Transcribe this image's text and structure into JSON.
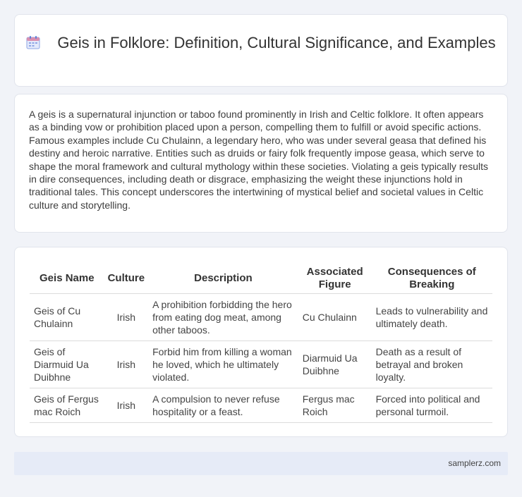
{
  "header": {
    "title": "Geis in Folklore: Definition, Cultural Significance, and Examples",
    "icon": "calendar-icon"
  },
  "intro": {
    "text": "A geis is a supernatural injunction or taboo found prominently in Irish and Celtic folklore. It often appears as a binding vow or prohibition placed upon a person, compelling them to fulfill or avoid specific actions. Famous examples include Cu Chulainn, a legendary hero, who was under several geasa that defined his destiny and heroic narrative. Entities such as druids or fairy folk frequently impose geasa, which serve to shape the moral framework and cultural mythology within these societies. Violating a geis typically results in dire consequences, including death or disgrace, emphasizing the weight these injunctions hold in traditional tales. This concept underscores the intertwining of mystical belief and societal values in Celtic culture and storytelling."
  },
  "table": {
    "headers": [
      "Geis Name",
      "Culture",
      "Description",
      "Associated Figure",
      "Consequences of Breaking"
    ],
    "rows": [
      [
        "Geis of Cu Chulainn",
        "Irish",
        "A prohibition forbidding the hero from eating dog meat, among other taboos.",
        "Cu Chulainn",
        "Leads to vulnerability and ultimately death."
      ],
      [
        "Geis of Diarmuid Ua Duibhne",
        "Irish",
        "Forbid him from killing a woman he loved, which he ultimately violated.",
        "Diarmuid Ua Duibhne",
        "Death as a result of betrayal and broken loyalty."
      ],
      [
        "Geis of Fergus mac Roich",
        "Irish",
        "A compulsion to never refuse hospitality or a feast.",
        "Fergus mac Roich",
        "Forced into political and personal turmoil."
      ]
    ]
  },
  "footer": {
    "site": "samplerz.com"
  },
  "colors": {
    "background": "#f1f3f8",
    "card": "#ffffff",
    "footer": "#e6ebf7",
    "icon_accent": "#5b7fd6"
  }
}
